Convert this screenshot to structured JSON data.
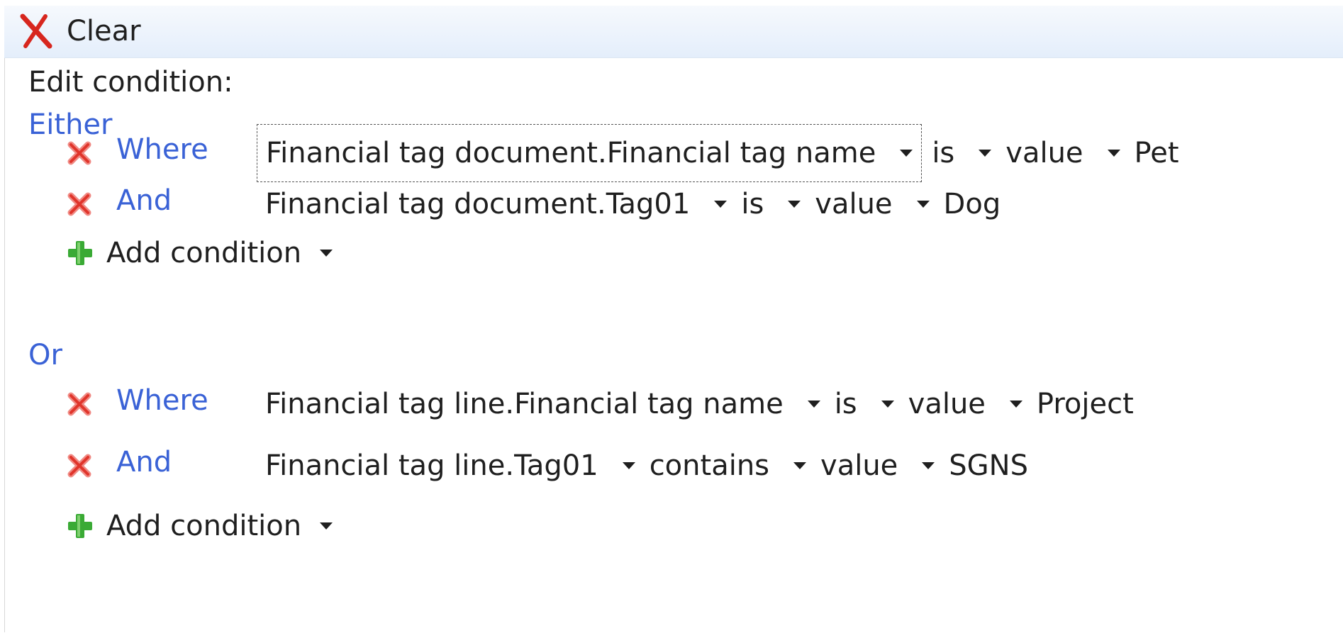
{
  "toolbar": {
    "clear_label": "Clear",
    "clear_icon": "close-x-icon"
  },
  "edit_label": "Edit condition:",
  "groups": [
    {
      "label": "Either",
      "rows": [
        {
          "connector": "Where",
          "field": "Financial tag document.Financial tag name",
          "operator": "is",
          "value_type": "value",
          "value": "Pet"
        },
        {
          "connector": "And",
          "field": "Financial tag document.Tag01",
          "operator": "is",
          "value_type": "value",
          "value": "Dog"
        }
      ],
      "add_label": "Add condition"
    },
    {
      "label": "Or",
      "rows": [
        {
          "connector": "Where",
          "field": "Financial tag line.Financial tag name",
          "operator": "is",
          "value_type": "value",
          "value": "Project"
        },
        {
          "connector": "And",
          "field": "Financial tag line.Tag01",
          "operator": "contains",
          "value_type": "value",
          "value": "SGNS"
        }
      ],
      "add_label": "Add condition"
    }
  ],
  "colors": {
    "link_blue": "#3a62d6",
    "remove_red": "#e0352b",
    "add_green": "#3aaa35",
    "toolbar_bg": "#e4eefb"
  }
}
